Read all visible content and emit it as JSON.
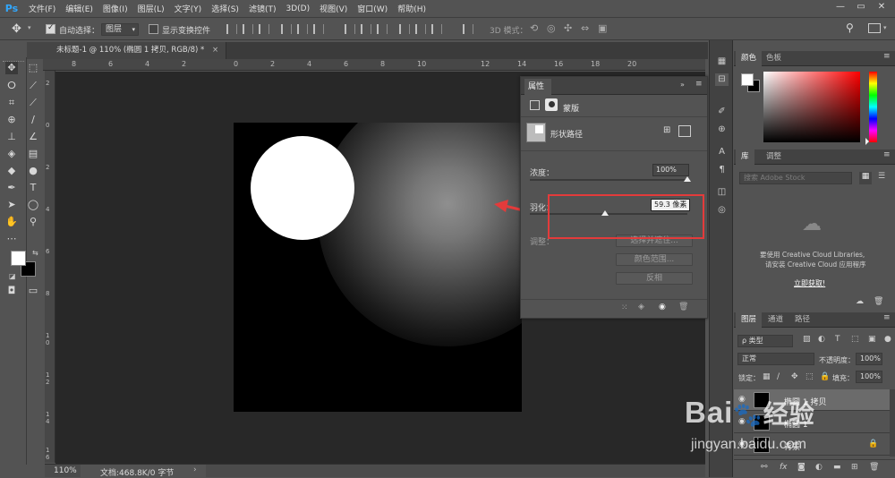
{
  "app": {
    "logo": "Ps"
  },
  "menubar": {
    "items": [
      "文件(F)",
      "编辑(E)",
      "图像(I)",
      "图层(L)",
      "文字(Y)",
      "选择(S)",
      "滤镜(T)",
      "3D(D)",
      "视图(V)",
      "窗口(W)",
      "帮助(H)"
    ]
  },
  "options": {
    "auto_select_label": "自动选择：",
    "auto_select_value": "图层",
    "show_transform_label": "显示变换控件",
    "mode_3d_label": "3D 模式："
  },
  "document": {
    "tab_title": "未标题-1 @ 110% (椭圆 1 拷贝, RGB/8) *",
    "close": "×"
  },
  "rulers": {
    "top": [
      "8",
      "6",
      "4",
      "2",
      "0",
      "2",
      "4",
      "6",
      "8",
      "10",
      "12",
      "14",
      "16",
      "18",
      "20"
    ],
    "left": [
      "2",
      "0",
      "2",
      "4",
      "6",
      "8",
      "1\n0",
      "1\n2",
      "1\n4",
      "1\n6"
    ]
  },
  "status": {
    "zoom": "110%",
    "doc_info": "文档:468.8K/0 字节",
    "arrow": "›"
  },
  "properties": {
    "tab": "属性",
    "section": "蒙版",
    "shape_path_label": "形状路径",
    "density_label": "浓度：",
    "density_value": "100%",
    "density_fraction": 1.0,
    "feather_label": "羽化：",
    "feather_value": "59.3 像素",
    "feather_fraction": 0.48,
    "adjust_label": "调整：",
    "select_edge_btn": "选择并遮住...",
    "color_range_btn": "颜色范围...",
    "invert_btn": "反相"
  },
  "swatches": {
    "tab_color": "颜色",
    "tab_swatch": "色板"
  },
  "library": {
    "tab_library": "库",
    "tab_adjust": "调整",
    "dropdown": "搜索 Adobe Stock",
    "message_line1": "要使用 Creative Cloud Libraries,",
    "message_line2": "请安装 Creative Cloud 应用程序",
    "link": "立即获取!"
  },
  "layers": {
    "tab_layers": "图层",
    "tab_channels": "通道",
    "tab_paths": "路径",
    "filter_type": "ρ 类型",
    "blend_mode": "正常",
    "opacity_label": "不透明度：",
    "opacity_value": "100%",
    "lock_label": "锁定：",
    "fill_label": "填充：",
    "fill_value": "100%",
    "rows": [
      {
        "name": "椭圆 1 拷贝"
      },
      {
        "name": "椭圆 1"
      },
      {
        "name": "背景"
      }
    ]
  },
  "watermark": {
    "brand": "Bai",
    "brand_tail": "经验",
    "url": "jingyan.baidu.com"
  },
  "colors": {
    "accent": "#31a8ff",
    "highlight_box": "#e33b3b",
    "panel_bg": "#535353",
    "canvas_bg": "#282828"
  }
}
